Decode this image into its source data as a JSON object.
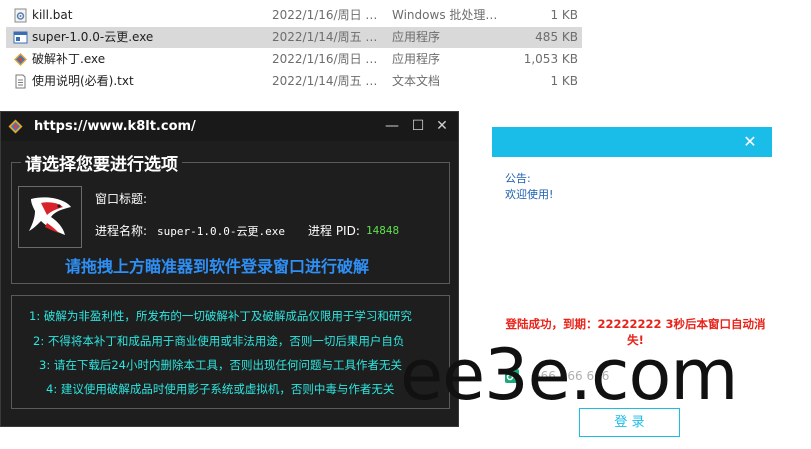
{
  "explorer": {
    "files": [
      {
        "name": "kill.bat",
        "date": "2022/1/16/周日 …",
        "type": "Windows 批处理…",
        "size": "1 KB",
        "icon": "batch-file-icon",
        "selected": false
      },
      {
        "name": "super-1.0.0-云更.exe",
        "date": "2022/1/14/周五 …",
        "type": "应用程序",
        "size": "485 KB",
        "icon": "exe-window-icon",
        "selected": true
      },
      {
        "name": "破解补丁.exe",
        "date": "2022/1/16/周日 …",
        "type": "应用程序",
        "size": "1,053 KB",
        "icon": "colorful-app-icon",
        "selected": false
      },
      {
        "name": "使用说明(必看).txt",
        "date": "2022/1/14/周五 …",
        "type": "文本文档",
        "size": "1 KB",
        "icon": "text-file-icon",
        "selected": false
      }
    ]
  },
  "crack_window": {
    "title": "https://www.k8lt.com/",
    "controls": {
      "minimize": "—",
      "maximize": "☐",
      "close": "✕"
    },
    "group_title": "请选择您要进行选项",
    "window_title_label": "窗口标题:",
    "process_name_label": "进程名称:",
    "process_name_value": "super-1.0.0-云更.exe",
    "pid_label": "进程 PID:",
    "pid_value": "14848",
    "drag_hint": "请拖拽上方瞄准器到软件登录窗口进行破解",
    "notices": [
      "1: 破解为非盈利性，所发布的一切破解补丁及破解成品仅限用于学习和研究",
      "2: 不得将本补丁和成品用于商业使用或非法用途，否则一切后果用户自负",
      "3: 请在下载后24小时内删除本工具，否则出现任何问题与工具作者无关",
      "4: 建议使用破解成品时使用影子系统或虚拟机，否则中毒与作者无关"
    ]
  },
  "login_window": {
    "close": "✕",
    "announcement_title": "公告:",
    "announcement_body": "欢迎使用!",
    "success_message": "登陆成功，到期：22222222  3秒后本窗口自动消失!",
    "key_value": "666 666 666",
    "login_button": "登 录",
    "accent_color": "#1abce8"
  },
  "watermark": "ee3e.com"
}
